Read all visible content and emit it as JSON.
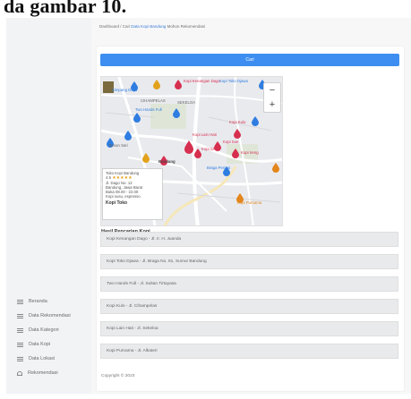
{
  "caption": "da gambar 10.",
  "breadcrumb": {
    "prefix": "Dashboard / Cari",
    "link": "Data Kopi Bandung",
    "suffix": "Mohon Rekomendasi"
  },
  "search_button": "Cari",
  "map": {
    "labels": [
      {
        "text": "Simpang Dago",
        "color": "#2f7de1"
      },
      {
        "text": "Kopi Kenangan Dago",
        "color": "#d62f4f"
      },
      {
        "text": "Kopi Toko Djawa",
        "color": "#2f7de1"
      },
      {
        "text": "CIHAMPELAS",
        "color": "#666666"
      },
      {
        "text": "Two Hands Full",
        "color": "#2f7de1"
      },
      {
        "text": "SEKELOA",
        "color": "#666666"
      },
      {
        "text": "Kopi Kulo",
        "color": "#d62f4f"
      },
      {
        "text": "Taman Sari",
        "color": "#666666"
      },
      {
        "text": "Kopi Lain Hati",
        "color": "#d62f4f"
      },
      {
        "text": "Kopi 123",
        "color": "#d62f4f"
      },
      {
        "text": "Kopi Soe",
        "color": "#d62f4f"
      },
      {
        "text": "Kopi Ireng",
        "color": "#d62f4f"
      },
      {
        "text": "Braga Permai",
        "color": "#2f7de1"
      },
      {
        "text": "Kopi Purnama",
        "color": "#e3861c"
      },
      {
        "text": "Bandung",
        "color": "#444444"
      }
    ],
    "popup": {
      "title": "Toko Kopi Bandung",
      "rating": "4.5",
      "stars": "★★★★★",
      "lines": [
        "Jl. Dago No. 12",
        "Bandung, Jawa Barat",
        "Buka 08.00 - 22.00",
        "Kopi susu, espresso"
      ],
      "name": "Kopi Toko"
    }
  },
  "results": {
    "title": "Hasil Pencarian Kopi",
    "rows": [
      "Kopi Kenangan Dago - Jl. Ir. H. Juanda",
      "Kopi Toko Djawa - Jl. Braga No. 81, Sumur Bandung",
      "Two Hands Full - Jl. Sultan Tirtayasa",
      "Kopi Kulo - Jl. Cihampelas",
      "Kopi Lain Hati - Jl. Sekeloa",
      "Kopi Purnama - Jl. Alkateri"
    ]
  },
  "footer": "Copyright © 2023",
  "sidebar": {
    "items": [
      {
        "label": "Beranda",
        "icon": "list-icon"
      },
      {
        "label": "Data Rekomendasi",
        "icon": "list-icon"
      },
      {
        "label": "Data Kategori",
        "icon": "list-icon"
      },
      {
        "label": "Data Kopi",
        "icon": "list-icon"
      },
      {
        "label": "Data Lokasi",
        "icon": "list-icon"
      },
      {
        "label": "Rekomendasi",
        "icon": "bag-icon"
      }
    ]
  }
}
